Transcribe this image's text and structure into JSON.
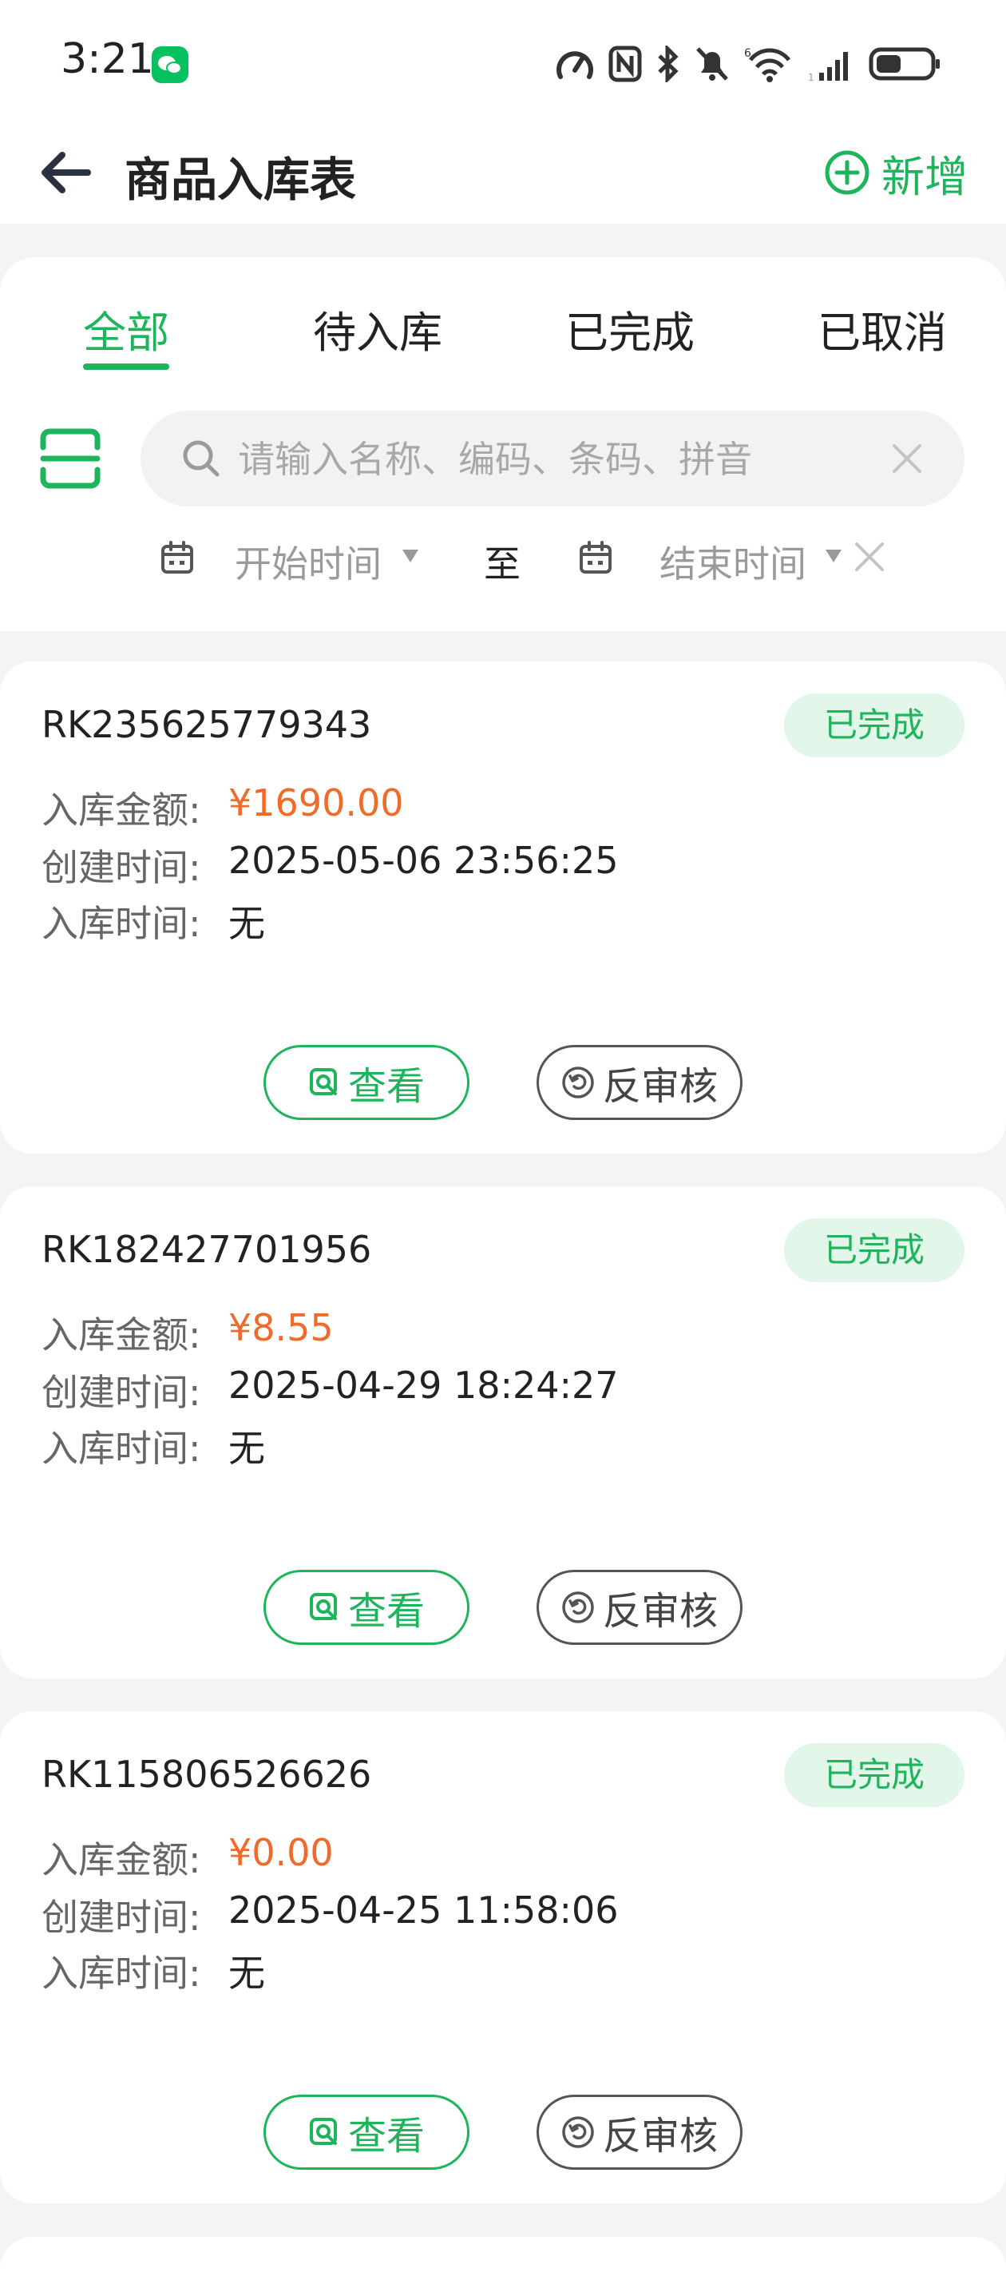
{
  "status_bar": {
    "time": "3:21",
    "wifi_badge": "6",
    "signal_badge": "1"
  },
  "header": {
    "title": "商品入库表",
    "add_label": "新增"
  },
  "tabs": [
    {
      "label": "全部",
      "active": true
    },
    {
      "label": "待入库",
      "active": false
    },
    {
      "label": "已完成",
      "active": false
    },
    {
      "label": "已取消",
      "active": false
    }
  ],
  "search": {
    "placeholder": "请输入名称、编码、条码、拼音",
    "value": ""
  },
  "date_filter": {
    "start_label": "开始时间",
    "separator": "至",
    "end_label": "结束时间"
  },
  "labels": {
    "amount": "入库金额:",
    "created": "创建时间:",
    "stocked": "入库时间:",
    "view": "查看",
    "reverse": "反审核"
  },
  "orders": [
    {
      "order_no": "RK235625779343",
      "status": "已完成",
      "amount": "¥1690.00",
      "created": "2025-05-06 23:56:25",
      "stocked": "无"
    },
    {
      "order_no": "RK182427701956",
      "status": "已完成",
      "amount": "¥8.55",
      "created": "2025-04-29 18:24:27",
      "stocked": "无"
    },
    {
      "order_no": "RK115806526626",
      "status": "已完成",
      "amount": "¥0.00",
      "created": "2025-04-25 11:58:06",
      "stocked": "无"
    }
  ],
  "colors": {
    "accent": "#1db45b",
    "amount": "#f06a2a",
    "badge_bg": "#e2f6e9"
  }
}
